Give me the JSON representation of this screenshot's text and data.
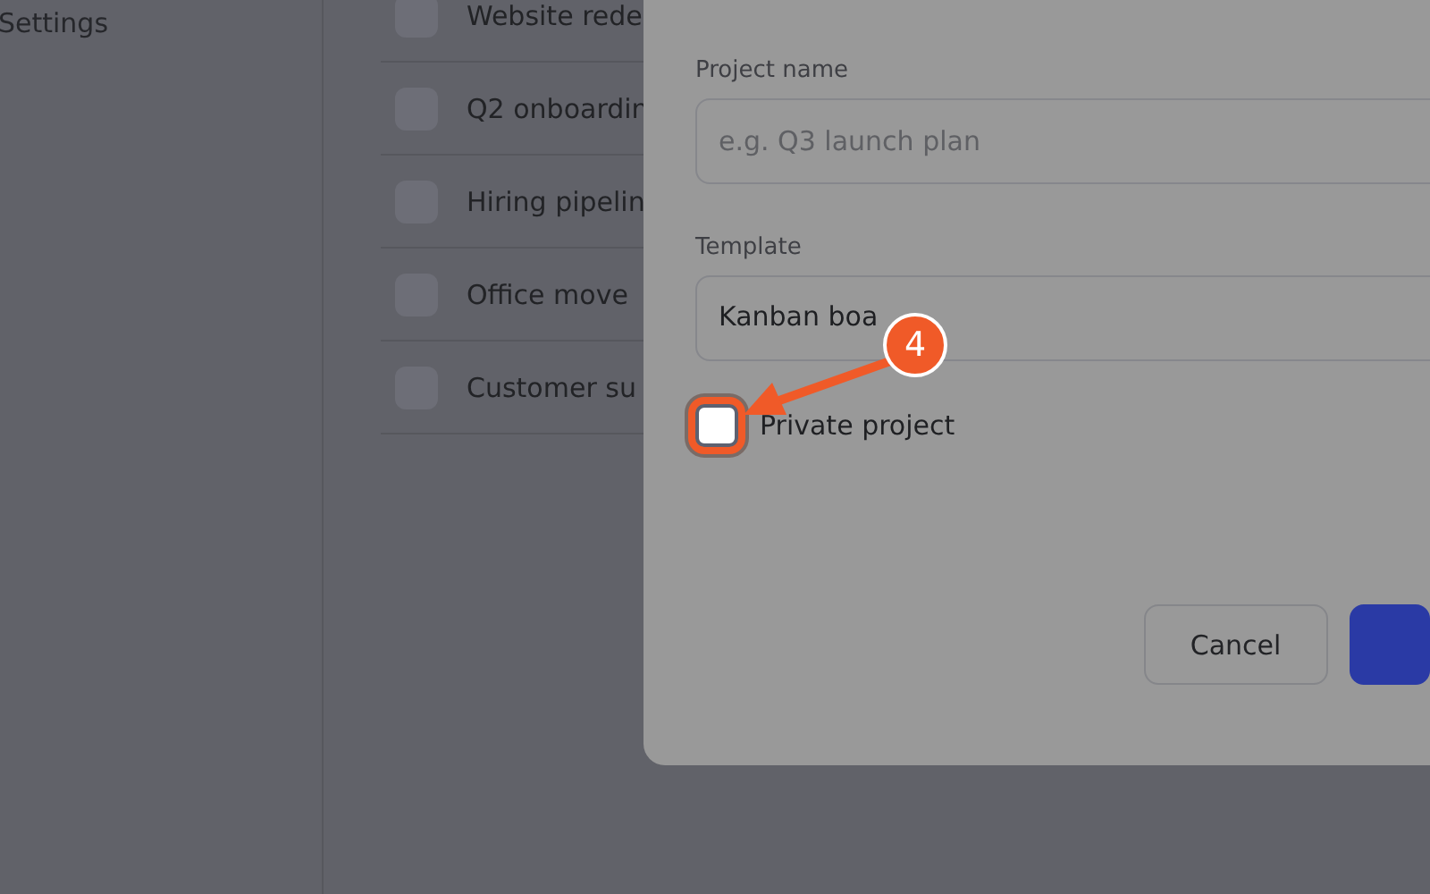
{
  "sidebar": {
    "items": [
      {
        "label": "Settings"
      }
    ]
  },
  "projects": [
    {
      "name": "Website rede"
    },
    {
      "name": "Q2 onboardin"
    },
    {
      "name": "Hiring pipelin"
    },
    {
      "name": "Office move"
    },
    {
      "name": "Customer su"
    }
  ],
  "dialog": {
    "fields": [
      {
        "kind": "text",
        "label": "Project name",
        "placeholder": "e.g. Q3 launch plan"
      },
      {
        "kind": "select",
        "label": "Template",
        "value": "Kanban boa"
      }
    ],
    "checkbox": {
      "label": "Private project",
      "checked": false
    },
    "buttons": [
      {
        "kind": "secondary",
        "label": "Cancel"
      },
      {
        "kind": "primary"
      }
    ]
  },
  "annotation": {
    "number": "4"
  }
}
